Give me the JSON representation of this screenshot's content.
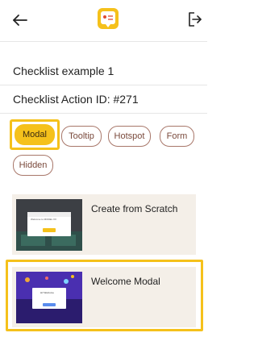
{
  "header": {
    "back_icon": "arrow-left-icon",
    "logo_icon": "checklist-logo-icon",
    "exit_icon": "log-out-icon",
    "accent": "#f5c11b"
  },
  "checklist": {
    "title": "Checklist example 1",
    "action_id": "Checklist Action ID: #271"
  },
  "filters": {
    "chips": [
      {
        "label": "Modal",
        "selected": true
      },
      {
        "label": "Tooltip",
        "selected": false
      },
      {
        "label": "Hotspot",
        "selected": false
      },
      {
        "label": "Form",
        "selected": false
      },
      {
        "label": "Hidden",
        "selected": false
      }
    ]
  },
  "templates": [
    {
      "label": "Create from Scratch",
      "thumbnail_text": "Welcome to MODEL XX"
    },
    {
      "label": "Welcome Modal",
      "thumbnail_text": "Hi! Welcome"
    }
  ]
}
